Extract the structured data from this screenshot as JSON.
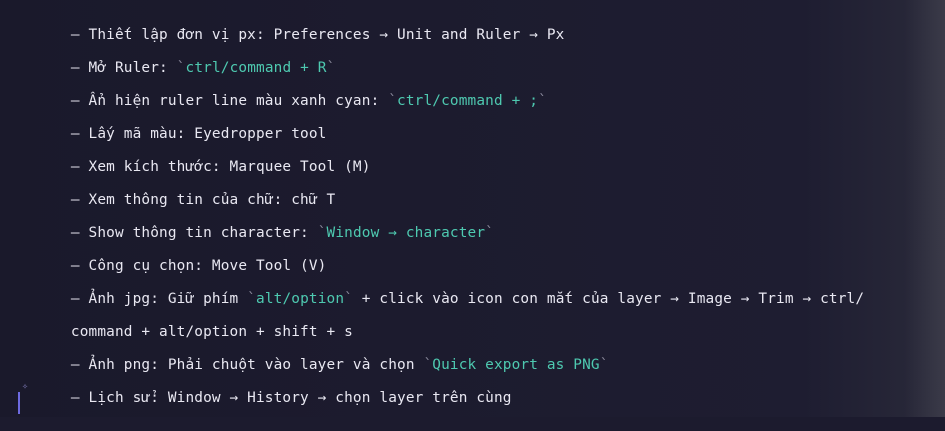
{
  "notes": {
    "lines": [
      {
        "prefix": "– Thiết lập đơn vị px: Preferences → Unit and Ruler → Px",
        "code": "",
        "suffix": ""
      },
      {
        "prefix": "– Mở Ruler: ",
        "code": "ctrl/command + R",
        "suffix": ""
      },
      {
        "prefix": "– Ẩn hiện ruler line màu xanh cyan: ",
        "code": "ctrl/command + ;",
        "suffix": ""
      },
      {
        "prefix": "– Lấy mã màu: Eyedropper tool",
        "code": "",
        "suffix": ""
      },
      {
        "prefix": "– Xem kích thước: Marquee Tool (M)",
        "code": "",
        "suffix": ""
      },
      {
        "prefix": "– Xem thông tin của chữ: chữ T",
        "code": "",
        "suffix": ""
      },
      {
        "prefix": "– Show thông tin character: ",
        "code": "Window → character",
        "suffix": ""
      },
      {
        "prefix": "– Công cụ chọn: Move Tool (V)",
        "code": "",
        "suffix": ""
      },
      {
        "prefix": "– Ảnh jpg: Giữ phím ",
        "code": "alt/option",
        "suffix": " + click vào icon con mắt của layer → Image → Trim → ctrl/"
      },
      {
        "prefix": "command + alt/option + shift + s",
        "code": "",
        "suffix": ""
      },
      {
        "prefix": "– Ảnh png: Phải chuột vào layer và chọn ",
        "code": "Quick export as PNG",
        "suffix": ""
      },
      {
        "prefix": "– Lịch sử: Window → History → chọn layer trên cùng",
        "code": "",
        "suffix": ""
      }
    ]
  },
  "colors": {
    "background": "#1c1b2e",
    "text": "#e9e8f2",
    "code": "#4ec9b0",
    "cursor": "#6d6ae0"
  },
  "icons": {
    "sparkle": "sparkle-icon"
  }
}
